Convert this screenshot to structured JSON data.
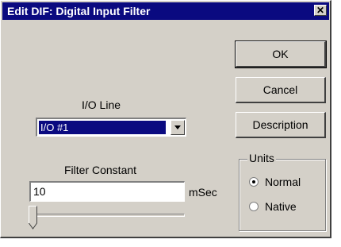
{
  "window": {
    "title": "Edit DIF:  Digital Input Filter",
    "close_symbol": "✕"
  },
  "buttons": {
    "ok": "OK",
    "cancel": "Cancel",
    "description": "Description"
  },
  "io_line": {
    "label": "I/O Line",
    "selected": "I/O #1"
  },
  "filter": {
    "label": "Filter Constant",
    "value": "10",
    "unit": "mSec",
    "slider_fraction": 0.0
  },
  "units": {
    "legend": "Units",
    "options": [
      "Normal",
      "Native"
    ],
    "selected": "Normal"
  }
}
